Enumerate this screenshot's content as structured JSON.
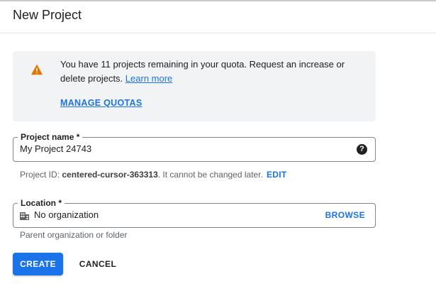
{
  "dialog": {
    "title": "New Project"
  },
  "notice": {
    "icon": "warning-icon",
    "icon_color": "#e37400",
    "text_main": "You have 11 projects remaining in your quota. Request an increase or delete projects.",
    "learn_more": "Learn more",
    "manage_quotas": "MANAGE QUOTAS"
  },
  "project_name": {
    "label": "Project name *",
    "value": "My Project 24743",
    "help_icon": "help-circle-icon"
  },
  "project_id": {
    "prefix": "Project ID:",
    "id": "centered-cursor-363313",
    "suffix": ". It cannot be changed later.",
    "edit_label": "EDIT"
  },
  "location": {
    "label": "Location *",
    "icon": "building-icon",
    "value": "No organization",
    "browse_label": "BROWSE",
    "hint": "Parent organization or folder"
  },
  "actions": {
    "create_label": "CREATE",
    "cancel_label": "CANCEL"
  },
  "colors": {
    "accent": "#1a73e8",
    "notice_bg": "#f1f3f4"
  }
}
